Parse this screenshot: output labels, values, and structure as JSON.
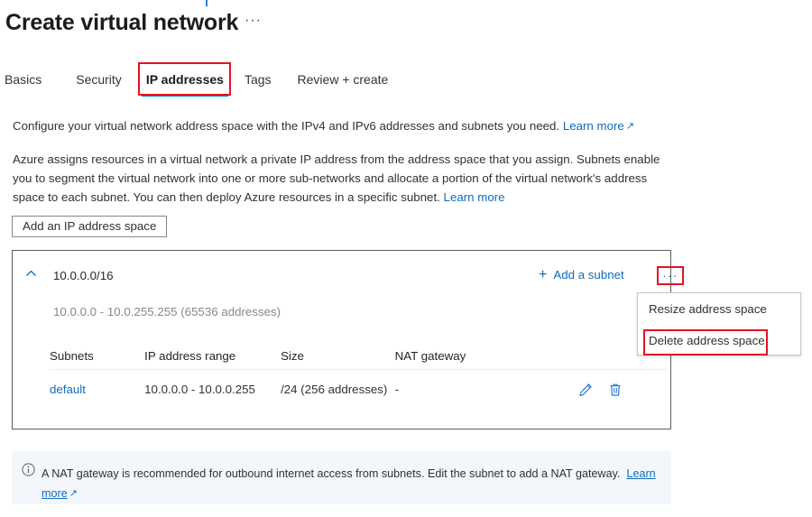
{
  "page": {
    "title": "Create virtual network",
    "title_ellipsis": "···"
  },
  "tabs": [
    {
      "label": "Basics",
      "selected": false
    },
    {
      "label": "Security",
      "selected": false
    },
    {
      "label": "IP addresses",
      "selected": true
    },
    {
      "label": "Tags",
      "selected": false
    },
    {
      "label": "Review + create",
      "selected": false
    }
  ],
  "description": {
    "paragraph1": "Configure your virtual network address space with the IPv4 and IPv6 addresses and subnets you need.",
    "paragraph1_link": "Learn more",
    "paragraph2": "Azure assigns resources in a virtual network a private IP address from the address space that you assign. Subnets enable you to segment the virtual network into one or more sub-networks and allocate a portion of the virtual network's address space to each subnet. You can then deploy Azure resources in a specific subnet.",
    "paragraph2_link": "Learn more"
  },
  "actions": {
    "add_ip_address_space": "Add an IP address space"
  },
  "address_space": {
    "cidr": "10.0.0.0/16",
    "range_summary": "10.0.0.0 - 10.0.255.255 (65536 addresses)",
    "collapse_icon": "chevron-up-icon",
    "add_subnet_label": "Add a subnet",
    "add_subnet_icon": "plus-icon",
    "more_menu_icon": "···"
  },
  "context_menu": {
    "items": [
      {
        "label": "Resize address space",
        "highlighted": false
      },
      {
        "label": "Delete address space",
        "highlighted": true
      }
    ]
  },
  "subnets_table": {
    "headers": [
      "Subnets",
      "IP address range",
      "Size",
      "NAT gateway"
    ],
    "rows": [
      {
        "subnet": "default",
        "ip_address_range": "10.0.0.0 - 10.0.0.255",
        "size": "/24 (256 addresses)",
        "nat_gateway": "-",
        "edit_icon": "pencil-icon",
        "delete_icon": "trash-icon"
      }
    ]
  },
  "info_banner": {
    "icon": "info-circle-icon",
    "text": "A NAT gateway is recommended for outbound internet access from subnets. Edit the subnet to add a NAT gateway.",
    "link": "Learn more"
  },
  "colors": {
    "accent_blue": "#0078d4",
    "link_blue": "#0f6cbd",
    "annotation_red": "#e81123",
    "banner_bg": "#f3f7fc",
    "muted_text": "#8a8886"
  }
}
